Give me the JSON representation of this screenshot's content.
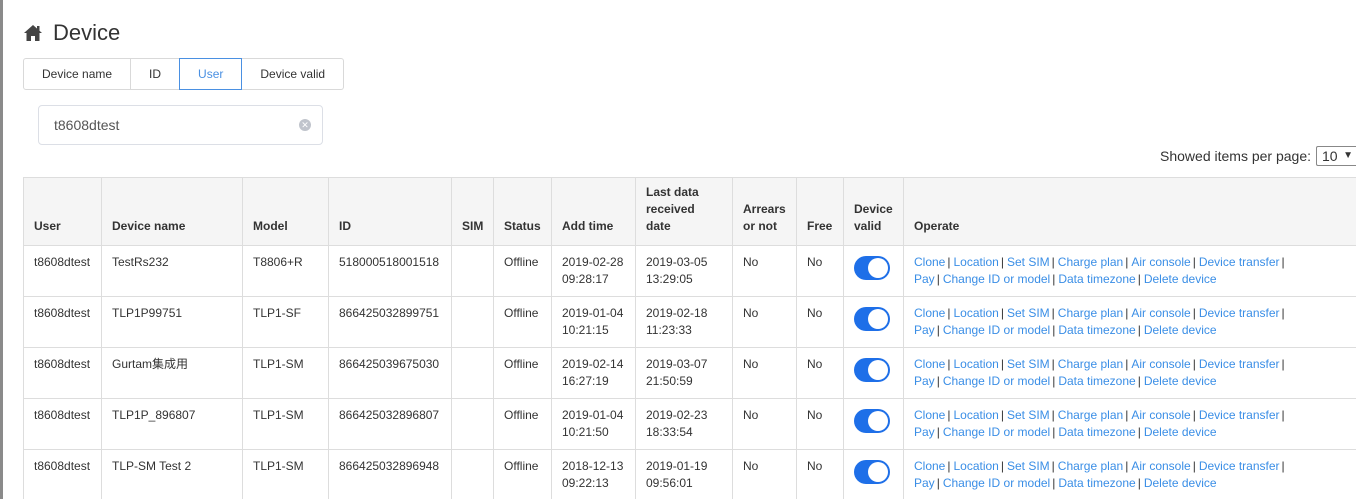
{
  "page": {
    "title": "Device",
    "icon": "home-icon"
  },
  "tabs": [
    {
      "label": "Device name",
      "active": false
    },
    {
      "label": "ID",
      "active": false
    },
    {
      "label": "User",
      "active": true
    },
    {
      "label": "Device valid",
      "active": false
    }
  ],
  "search": {
    "value": "t8608dtest"
  },
  "pagination": {
    "label": "Showed items per page:",
    "per_page": "10"
  },
  "table": {
    "headers": [
      "User",
      "Device name",
      "Model",
      "ID",
      "SIM",
      "Status",
      "Add time",
      "Last data received date",
      "Arrears or not",
      "Free",
      "Device valid",
      "Operate"
    ],
    "operations": [
      "Clone",
      "Location",
      "Set SIM",
      "Charge plan",
      "Air console",
      "Device transfer",
      "Pay",
      "Change ID or model",
      "Data timezone",
      "Delete device"
    ],
    "rows": [
      {
        "user": "t8608dtest",
        "device_name": "TestRs232",
        "model": "T8806+R",
        "id": "518000518001518",
        "sim": "",
        "status": "Offline",
        "add_date": "2019-02-28",
        "add_time": "09:28:17",
        "last_date": "2019-03-05",
        "last_time": "13:29:05",
        "arrears": "No",
        "free": "No",
        "valid": true
      },
      {
        "user": "t8608dtest",
        "device_name": "TLP1P99751",
        "model": "TLP1-SF",
        "id": "866425032899751",
        "sim": "",
        "status": "Offline",
        "add_date": "2019-01-04",
        "add_time": "10:21:15",
        "last_date": "2019-02-18",
        "last_time": "11:23:33",
        "arrears": "No",
        "free": "No",
        "valid": true
      },
      {
        "user": "t8608dtest",
        "device_name": "Gurtam集成用",
        "model": "TLP1-SM",
        "id": "866425039675030",
        "sim": "",
        "status": "Offline",
        "add_date": "2019-02-14",
        "add_time": "16:27:19",
        "last_date": "2019-03-07",
        "last_time": "21:50:59",
        "arrears": "No",
        "free": "No",
        "valid": true
      },
      {
        "user": "t8608dtest",
        "device_name": "TLP1P_896807",
        "model": "TLP1-SM",
        "id": "866425032896807",
        "sim": "",
        "status": "Offline",
        "add_date": "2019-01-04",
        "add_time": "10:21:50",
        "last_date": "2019-02-23",
        "last_time": "18:33:54",
        "arrears": "No",
        "free": "No",
        "valid": true
      },
      {
        "user": "t8608dtest",
        "device_name": "TLP-SM Test 2",
        "model": "TLP1-SM",
        "id": "866425032896948",
        "sim": "",
        "status": "Offline",
        "add_date": "2018-12-13",
        "add_time": "09:22:13",
        "last_date": "2019-01-19",
        "last_time": "09:56:01",
        "arrears": "No",
        "free": "No",
        "valid": true
      }
    ]
  },
  "colors": {
    "accent": "#4a90e2",
    "link": "#3a8ee6",
    "toggle_on": "#1e6fe8"
  }
}
